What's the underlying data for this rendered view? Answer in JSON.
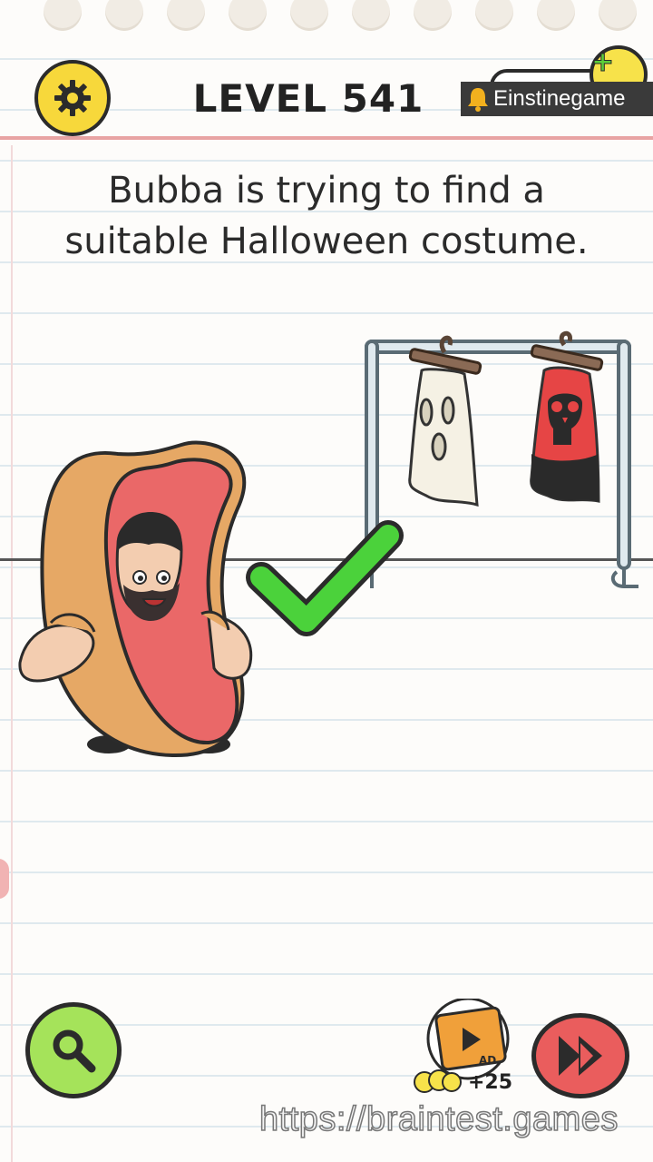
{
  "level": {
    "title": "LEVEL 541"
  },
  "question": {
    "line1": "Bubba is trying to find a",
    "line2": "suitable Halloween costume."
  },
  "watermark_top": {
    "text": "Einstinegame"
  },
  "watermark_bottom": {
    "text": "https://braintest.games"
  },
  "ad_reward": {
    "label": "+25",
    "badge": "AD"
  },
  "icons": {
    "settings": "gear-icon",
    "search": "magnifier-icon",
    "skip": "fast-forward-icon",
    "hint": "lightbulb-icon",
    "bell": "bell-icon"
  },
  "colors": {
    "settings_bg": "#f7d83b",
    "search_bg": "#a5e35a",
    "skip_bg": "#ea5d5d",
    "check": "#4bd23b",
    "red_line": "#e8a3a3"
  }
}
